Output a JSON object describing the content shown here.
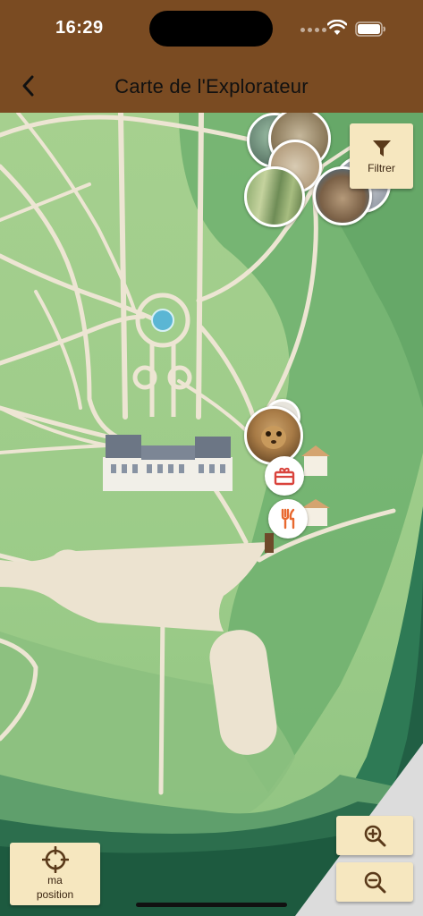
{
  "status_bar": {
    "time": "16:29"
  },
  "header": {
    "title": "Carte de l'Explorateur"
  },
  "controls": {
    "filter_label": "Filtrer",
    "position_label_line1": "ma",
    "position_label_line2": "position"
  },
  "colors": {
    "header": "#7a4b22",
    "button_cream": "#f6e7bf",
    "restaurant_marker": "#e8692f",
    "shop_marker": "#d9433c"
  }
}
